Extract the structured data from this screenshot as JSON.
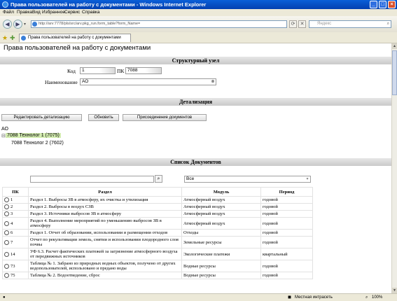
{
  "window": {
    "title": "Права пользователей на работу с документами - Windows Internet Explorer",
    "min_glyph": "_",
    "max_glyph": "□",
    "close_glyph": "×"
  },
  "menu": [
    "Файл",
    "Правка",
    "Вид",
    "Избранное",
    "Сервис",
    "Справка"
  ],
  "address": {
    "url": "http://arv:7778/pls/src/arv.pkg_run.form_table?form_Name=",
    "refresh_glyph": "⟳",
    "stop_glyph": "✕",
    "search_placeholder": "Яндекс"
  },
  "tab": {
    "title": "Права пользователей на работу с документами"
  },
  "page": {
    "title": "Права пользователей на работу с документами"
  },
  "structure": {
    "heading": "Структурный узел",
    "code_label": "Код",
    "code_value": "1",
    "pk_label": "ПК",
    "pk_value": "7088",
    "name_label": "Наименование",
    "name_value": "АО"
  },
  "detail": {
    "heading": "Детализация",
    "edit_button": "Редактировать детализацию",
    "refresh_button": "Обновить",
    "attach_button": "Присоединение документов"
  },
  "tree": {
    "root": "АО",
    "expander": "⊟",
    "items": [
      {
        "label": "7088 Технолог 1",
        "code": "(7075)"
      },
      {
        "label": "7088 Технолог 2",
        "code": "(7602)"
      }
    ]
  },
  "documents": {
    "heading": "Список Документов",
    "filter_value": "Все",
    "columns": {
      "pk": "ПК",
      "section": "Раздел",
      "module": "Модуль",
      "period": "Период"
    },
    "rows": [
      {
        "pk": "1",
        "section": "Раздел 1. Выбросы ЗВ в атмосферу, их очистка и утилизация",
        "module": "Атмосферный воздух",
        "period": "годовой"
      },
      {
        "pk": "2",
        "section": "Раздел 2. Выбросы в воздух СЗВ",
        "module": "Атмосферный воздух",
        "period": "годовой"
      },
      {
        "pk": "3",
        "section": "Раздел 3. Источники выбросов ЗВ в атмосферу",
        "module": "Атмосферный воздух",
        "period": "годовой"
      },
      {
        "pk": "4",
        "section": "Раздел 4. Выполнение мероприятий по уменьшению выбросов ЗВ в атмосферу",
        "module": "Атмосферный воздух",
        "period": "годовой"
      },
      {
        "pk": "6",
        "section": "Раздел 1. Отчет об образовании, использовании и размещении отходов",
        "module": "Отходы",
        "period": "годовой"
      },
      {
        "pk": "7",
        "section": "Отчет по рекультивации земель, снятии и использовании плодородного слоя почвы",
        "module": "Земельные ресурсы",
        "period": "годовой"
      },
      {
        "pk": "14",
        "section": "УФ 6.3. Расчет фактических платежей за загрязнение атмосферного воздуха от передвижных источников",
        "module": "Экологические платежи",
        "period": "квартальный"
      },
      {
        "pk": "73",
        "section": "Таблица № 1. Забрано из природных водных объектов, получено от других водопользователей, использовано и предано воды",
        "module": "Водные ресурсы",
        "period": "годовой"
      },
      {
        "pk": "75",
        "section": "Таблица № 2. Водоотведение, сброс",
        "module": "Водные ресурсы",
        "period": "годовой"
      }
    ]
  },
  "status": {
    "zone": "Местная интрасеть",
    "zoom": "100%"
  }
}
